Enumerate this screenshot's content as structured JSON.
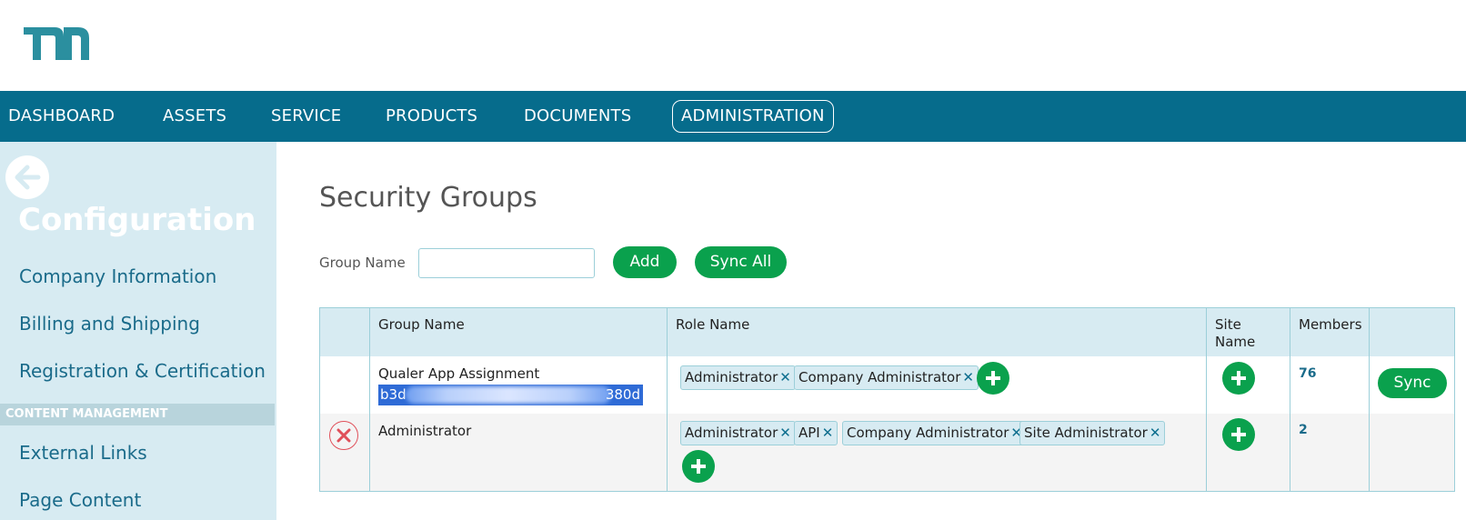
{
  "nav": {
    "items": [
      "DASHBOARD",
      "ASSETS",
      "SERVICE",
      "PRODUCTS",
      "DOCUMENTS",
      "ADMINISTRATION"
    ],
    "active": "ADMINISTRATION"
  },
  "sidebar": {
    "title": "Configuration",
    "links": [
      "Company Information",
      "Billing and Shipping",
      "Registration & Certification"
    ],
    "section_header": "CONTENT MANAGEMENT",
    "section_links": [
      "External Links",
      "Page Content"
    ]
  },
  "main": {
    "title": "Security Groups",
    "group_name_label": "Group Name",
    "group_name_value": "",
    "add_label": "Add",
    "sync_all_label": "Sync All"
  },
  "table": {
    "headers": {
      "group_name": "Group Name",
      "role_name": "Role Name",
      "site_name_line1": "Site",
      "site_name_line2": "Name",
      "members": "Members"
    },
    "rows": [
      {
        "group_name": "Qualer App Assignment",
        "group_id_start": "b3d",
        "group_id_end": "380d",
        "roles": [
          "Administrator",
          "Company Administrator"
        ],
        "members": "76",
        "sync_label": "Sync"
      },
      {
        "group_name": "Administrator",
        "roles": [
          "Administrator",
          "API",
          "Company Administrator",
          "Site Administrator"
        ],
        "members": "2"
      }
    ]
  },
  "colors": {
    "nav_bg": "#066c8c",
    "sidebar_bg": "#d7ebf2",
    "accent_green": "#0aa14d",
    "logo": "#2b8f9f",
    "delete_red": "#e0505a",
    "selection_blue": "#2f6bd6"
  },
  "icons": {
    "logo": "company-logo",
    "back": "arrow-left-icon",
    "add_role": "plus-icon",
    "delete": "close-icon",
    "remove_chip": "x-icon"
  }
}
